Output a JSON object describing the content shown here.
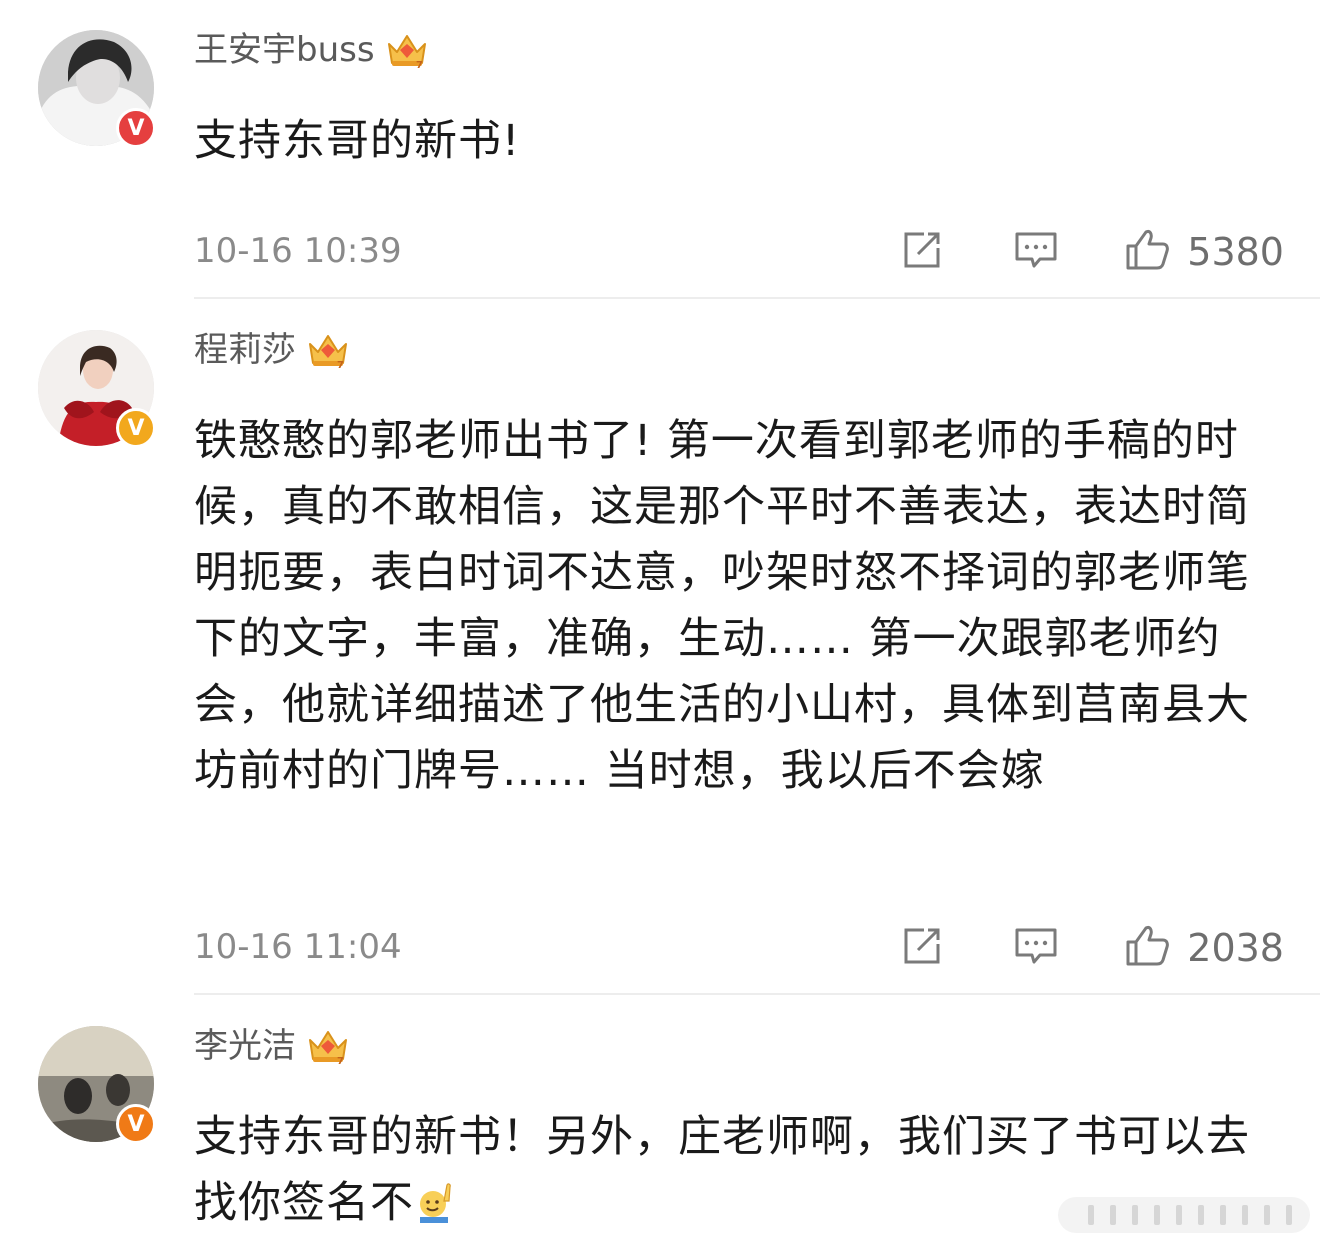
{
  "comments": [
    {
      "name": "王安宇buss",
      "badge_color": "#e53f3f",
      "text": "支持东哥的新书!",
      "time": "10-16 10:39",
      "likes": "5380"
    },
    {
      "name": "程莉莎",
      "badge_color": "#f2a81d",
      "text": "铁憨憨的郭老师出书了! 第一次看到郭老师的手稿的时候，真的不敢相信，这是那个平时不善表达，表达时简明扼要，表白时词不达意，吵架时怒不择词的郭老师笔下的文字，丰富，准确，生动…… 第一次跟郭老师约会，他就详细描述了他生活的小山村，具体到莒南县大坊前村的门牌号…… 当时想，我以后不会嫁",
      "time": "10-16 11:04",
      "likes": "2038"
    },
    {
      "name": "李光洁",
      "badge_color": "#f07a16",
      "text": "支持东哥的新书！另外，庄老师啊，我们买了书可以去找你签名不",
      "emoji": "raising-hand-emoji"
    }
  ],
  "icons": {
    "verified_badge": "V",
    "crown": "crown-icon",
    "share": "share-icon",
    "reply": "comment-icon",
    "like": "thumbs-up-icon"
  },
  "colors": {
    "name": "#5a5a5a",
    "meta": "#8a8a8a",
    "divider": "#ededed"
  }
}
